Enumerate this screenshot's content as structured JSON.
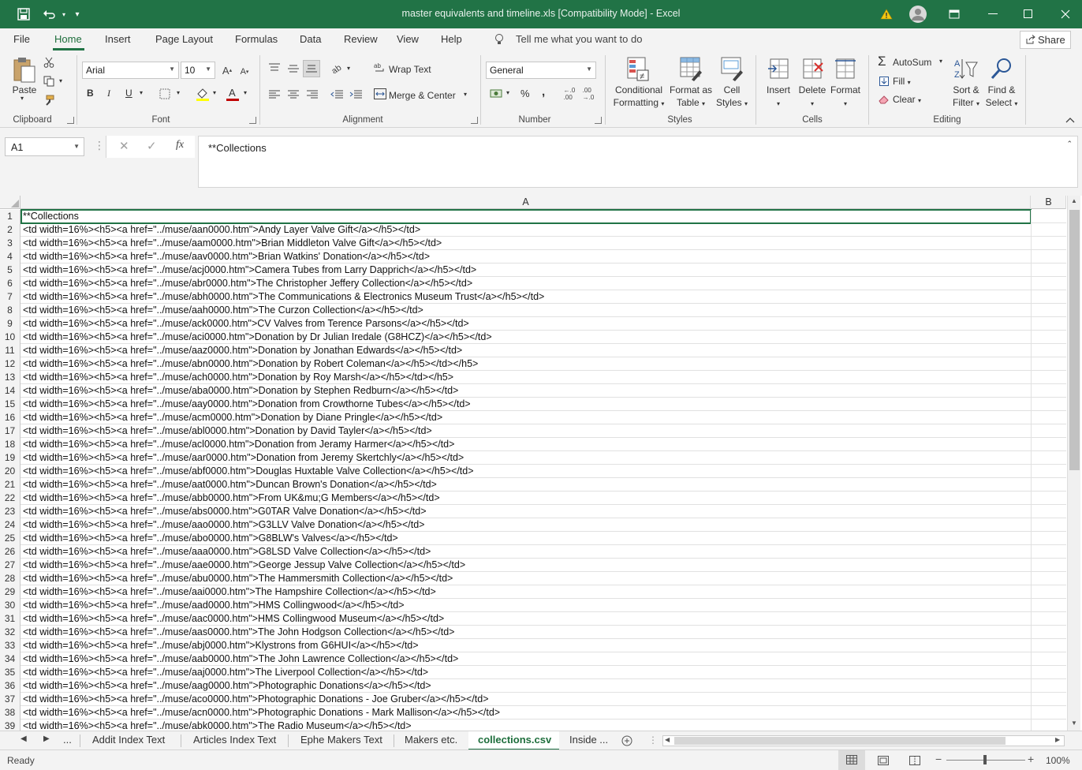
{
  "titlebar": {
    "title": "master equivalents and timeline.xls  [Compatibility Mode]  -  Excel",
    "warning_icon": "warning-icon",
    "colors": {
      "background": "#217346"
    }
  },
  "menu": {
    "tabs": [
      "File",
      "Home",
      "Insert",
      "Page Layout",
      "Formulas",
      "Data",
      "Review",
      "View",
      "Help"
    ],
    "active": "Home",
    "tell_me": "Tell me what you want to do",
    "share": "Share"
  },
  "ribbon": {
    "clipboard": {
      "paste": "Paste",
      "label": "Clipboard"
    },
    "font": {
      "name": "Arial",
      "size": "10",
      "bold": "B",
      "italic": "I",
      "underline": "U",
      "label": "Font",
      "text_color": "#c00000",
      "highlight_color": "#ffff00"
    },
    "alignment": {
      "wrap": "Wrap Text",
      "merge": "Merge & Center",
      "label": "Alignment"
    },
    "number": {
      "format": "General",
      "percent": "%",
      "comma": ",",
      "label": "Number"
    },
    "styles": {
      "conditional_1": "Conditional",
      "conditional_2": "Formatting",
      "format_table_1": "Format as",
      "format_table_2": "Table",
      "cell_styles_1": "Cell",
      "cell_styles_2": "Styles",
      "label": "Styles"
    },
    "cells": {
      "insert": "Insert",
      "delete": "Delete",
      "format": "Format",
      "label": "Cells"
    },
    "editing": {
      "autosum": "AutoSum",
      "fill": "Fill",
      "clear": "Clear",
      "sort_1": "Sort &",
      "sort_2": "Filter",
      "find_1": "Find &",
      "find_2": "Select",
      "label": "Editing"
    }
  },
  "formula_bar": {
    "name_box": "A1",
    "fx": "fx",
    "content": "**Collections"
  },
  "grid": {
    "columns": [
      "A",
      "B"
    ],
    "rows": [
      {
        "n": "1",
        "a": "**Collections"
      },
      {
        "n": "2",
        "a": "<td width=16%><h5><a href=\"../muse/aan0000.htm\">Andy Layer Valve Gift</a></h5></td>"
      },
      {
        "n": "3",
        "a": "<td width=16%><h5><a href=\"../muse/aam0000.htm\">Brian Middleton Valve Gift</a></h5></td>"
      },
      {
        "n": "4",
        "a": "<td width=16%><h5><a href=\"../muse/aav0000.htm\">Brian Watkins' Donation</a></h5></td>"
      },
      {
        "n": "5",
        "a": "<td width=16%><h5><a href=\"../muse/acj0000.htm\">Camera Tubes from Larry Dapprich</a></h5></td>"
      },
      {
        "n": "6",
        "a": "<td width=16%><h5><a href=\"../muse/abr0000.htm\">The Christopher Jeffery Collection</a></h5></td>"
      },
      {
        "n": "7",
        "a": "<td width=16%><h5><a href=\"../muse/abh0000.htm\">The Communications & Electronics Museum Trust</a></h5></td>"
      },
      {
        "n": "8",
        "a": "<td width=16%><h5><a href=\"../muse/aah0000.htm\">The Curzon Collection</a></h5></td>"
      },
      {
        "n": "9",
        "a": "<td width=16%><h5><a href=\"../muse/ack0000.htm\">CV Valves from Terence Parsons</a></h5></td>"
      },
      {
        "n": "10",
        "a": "<td width=16%><h5><a href=\"../muse/aci0000.htm\">Donation by Dr Julian Iredale (G8HCZ)</a></h5></td>"
      },
      {
        "n": "11",
        "a": "<td width=16%><h5><a href=\"../muse/aaz0000.htm\">Donation by Jonathan Edwards</a></h5></td>"
      },
      {
        "n": "12",
        "a": "<td width=16%><h5><a href=\"../muse/abn0000.htm\">Donation by Robert Coleman</a></h5></td></h5>"
      },
      {
        "n": "13",
        "a": "<td width=16%><h5><a href=\"../muse/ach0000.htm\">Donation by Roy Marsh</a></h5></td></h5>"
      },
      {
        "n": "14",
        "a": "<td width=16%><h5><a href=\"../muse/aba0000.htm\">Donation by Stephen Redburn</a></h5></td>"
      },
      {
        "n": "15",
        "a": "<td width=16%><h5><a href=\"../muse/aay0000.htm\">Donation from Crowthorne Tubes</a></h5></td>"
      },
      {
        "n": "16",
        "a": "<td width=16%><h5><a href=\"../muse/acm0000.htm\">Donation by Diane Pringle</a></h5></td>"
      },
      {
        "n": "17",
        "a": "<td width=16%><h5><a href=\"../muse/abl0000.htm\">Donation by David Tayler</a></h5></td>"
      },
      {
        "n": "18",
        "a": "<td width=16%><h5><a href=\"../muse/acl0000.htm\">Donation from Jeramy Harmer</a></h5></td>"
      },
      {
        "n": "19",
        "a": "<td width=16%><h5><a href=\"../muse/aar0000.htm\">Donation from Jeremy Skertchly</a></h5></td>"
      },
      {
        "n": "20",
        "a": "<td width=16%><h5><a href=\"../muse/abf0000.htm\">Douglas Huxtable Valve Collection</a></h5></td>"
      },
      {
        "n": "21",
        "a": "<td width=16%><h5><a href=\"../muse/aat0000.htm\">Duncan Brown's Donation</a></h5></td>"
      },
      {
        "n": "22",
        "a": "<td width=16%><h5><a href=\"../muse/abb0000.htm\">From UK&mu;G Members</a></h5></td>"
      },
      {
        "n": "23",
        "a": "<td width=16%><h5><a href=\"../muse/abs0000.htm\">G0TAR Valve Donation</a></h5></td>"
      },
      {
        "n": "24",
        "a": "<td width=16%><h5><a href=\"../muse/aao0000.htm\">G3LLV Valve Donation</a></h5></td>"
      },
      {
        "n": "25",
        "a": "<td width=16%><h5><a href=\"../muse/abo0000.htm\">G8BLW's Valves</a></h5></td>"
      },
      {
        "n": "26",
        "a": "<td width=16%><h5><a href=\"../muse/aaa0000.htm\">G8LSD Valve Collection</a></h5></td>"
      },
      {
        "n": "27",
        "a": "<td width=16%><h5><a href=\"../muse/aae0000.htm\">George Jessup Valve Collection</a></h5></td>"
      },
      {
        "n": "28",
        "a": "<td width=16%><h5><a href=\"../muse/abu0000.htm\">The Hammersmith Collection</a></h5></td>"
      },
      {
        "n": "29",
        "a": "<td width=16%><h5><a href=\"../muse/aai0000.htm\">The Hampshire Collection</a></h5></td>"
      },
      {
        "n": "30",
        "a": "<td width=16%><h5><a href=\"../muse/aad0000.htm\">HMS Collingwood</a></h5></td>"
      },
      {
        "n": "31",
        "a": "<td width=16%><h5><a href=\"../muse/aac0000.htm\">HMS Collingwood Museum</a></h5></td>"
      },
      {
        "n": "32",
        "a": "<td width=16%><h5><a href=\"../muse/aas0000.htm\">The John Hodgson Collection</a></h5></td>"
      },
      {
        "n": "33",
        "a": "<td width=16%><h5><a href=\"../muse/abj0000.htm\">Klystrons from G6HUI</a></h5></td>"
      },
      {
        "n": "34",
        "a": "<td width=16%><h5><a href=\"../muse/aab0000.htm\">The John Lawrence Collection</a></h5></td>"
      },
      {
        "n": "35",
        "a": "<td width=16%><h5><a href=\"../muse/aaj0000.htm\">The Liverpool Collection</a></h5></td>"
      },
      {
        "n": "36",
        "a": "<td width=16%><h5><a href=\"../muse/aag0000.htm\">Photographic Donations</a></h5></td>"
      },
      {
        "n": "37",
        "a": "<td width=16%><h5><a href=\"../muse/aco0000.htm\">Photographic Donations - Joe Gruber</a></h5></td>"
      },
      {
        "n": "38",
        "a": "<td width=16%><h5><a href=\"../muse/acn0000.htm\">Photographic Donations - Mark Mallison</a></h5></td>"
      },
      {
        "n": "39",
        "a": "<td width=16%><h5><a href=\"../muse/abk0000.htm\">The Radio Museum</a></h5></td>"
      }
    ]
  },
  "sheet_tabs": {
    "more": "...",
    "tabs": [
      "Addit Index Text",
      "Articles Index Text",
      "Ephe Makers Text",
      "Makers etc.",
      "collections.csv",
      "Inside ..."
    ],
    "active": "collections.csv"
  },
  "status": {
    "ready": "Ready",
    "zoom": "100%"
  }
}
